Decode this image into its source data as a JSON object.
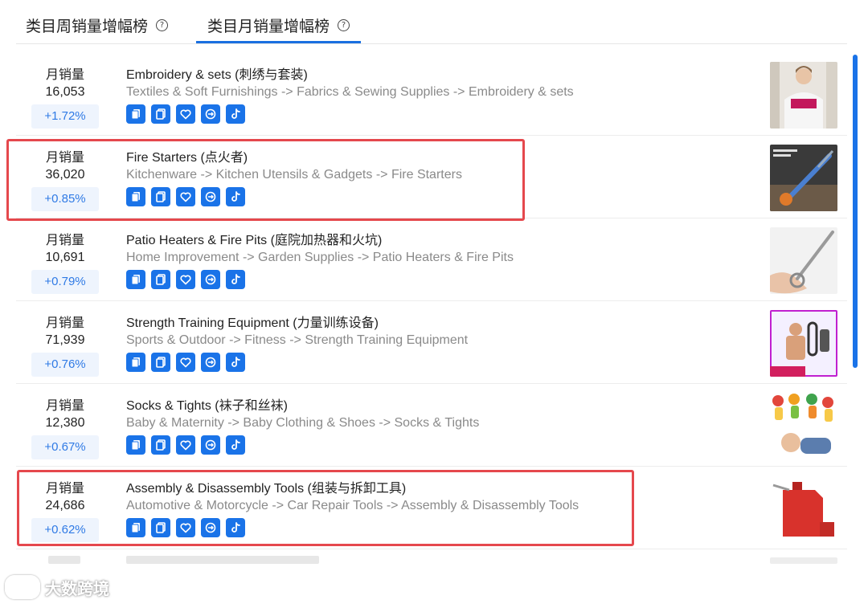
{
  "tabs": [
    {
      "label": "类目周销量增幅榜",
      "help": "?",
      "active": false
    },
    {
      "label": "类目月销量增幅榜",
      "help": "?",
      "active": true
    }
  ],
  "rows": [
    {
      "stat_label": "月销量",
      "stat_value": "16,053",
      "pct": "+1.72%",
      "title": "Embroidery & sets (刺绣与套装)",
      "path": "Textiles & Soft Furnishings -> Fabrics & Sewing Supplies -> Embroidery & sets",
      "highlighted": false
    },
    {
      "stat_label": "月销量",
      "stat_value": "36,020",
      "pct": "+0.85%",
      "title": "Fire Starters (点火者)",
      "path": "Kitchenware -> Kitchen Utensils & Gadgets -> Fire Starters",
      "highlighted": true
    },
    {
      "stat_label": "月销量",
      "stat_value": "10,691",
      "pct": "+0.79%",
      "title": "Patio Heaters & Fire Pits (庭院加热器和火坑)",
      "path": "Home Improvement -> Garden Supplies -> Patio Heaters & Fire Pits",
      "highlighted": false
    },
    {
      "stat_label": "月销量",
      "stat_value": "71,939",
      "pct": "+0.76%",
      "title": "Strength Training Equipment (力量训练设备)",
      "path": "Sports & Outdoor -> Fitness -> Strength Training Equipment",
      "highlighted": false
    },
    {
      "stat_label": "月销量",
      "stat_value": "12,380",
      "pct": "+0.67%",
      "title": "Socks & Tights (袜子和丝袜)",
      "path": "Baby & Maternity -> Baby Clothing & Shoes -> Socks & Tights",
      "highlighted": false
    },
    {
      "stat_label": "月销量",
      "stat_value": "24,686",
      "pct": "+0.62%",
      "title": "Assembly & Disassembly Tools (组装与拆卸工具)",
      "path": "Automotive & Motorcycle -> Car Repair Tools -> Assembly & Disassembly Tools",
      "highlighted": true
    }
  ],
  "icons": [
    "copy-icon",
    "duplicate-icon",
    "heart-icon",
    "analysis-icon",
    "tiktok-icon"
  ],
  "watermark": {
    "text": "大数跨境"
  },
  "colors": {
    "accent": "#1a73e8",
    "highlight": "#e5484d",
    "pct_bg": "#eef4fd",
    "pct_text": "#2f7ae5"
  }
}
